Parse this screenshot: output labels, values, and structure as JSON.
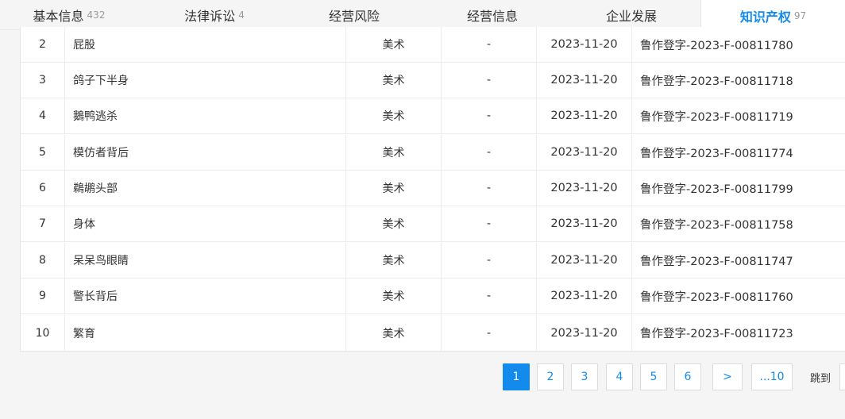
{
  "tabs": [
    {
      "label": "基本信息",
      "count": "432",
      "active": false
    },
    {
      "label": "法律诉讼",
      "count": "4",
      "active": false
    },
    {
      "label": "经营风险",
      "count": "",
      "active": false
    },
    {
      "label": "经营信息",
      "count": "",
      "active": false
    },
    {
      "label": "企业发展",
      "count": "",
      "active": false
    },
    {
      "label": "知识产权",
      "count": "97",
      "active": true
    }
  ],
  "rows": [
    {
      "idx": "2",
      "name": "屁股",
      "category": "美术",
      "dash": "-",
      "date": "2023-11-20",
      "reg_no": "鲁作登字-2023-F-00811780"
    },
    {
      "idx": "3",
      "name": "鸽子下半身",
      "category": "美术",
      "dash": "-",
      "date": "2023-11-20",
      "reg_no": "鲁作登字-2023-F-00811718"
    },
    {
      "idx": "4",
      "name": "鵝鸭逃杀",
      "category": "美术",
      "dash": "-",
      "date": "2023-11-20",
      "reg_no": "鲁作登字-2023-F-00811719"
    },
    {
      "idx": "5",
      "name": "模仿者背后",
      "category": "美术",
      "dash": "-",
      "date": "2023-11-20",
      "reg_no": "鲁作登字-2023-F-00811774"
    },
    {
      "idx": "6",
      "name": "鵜鹕头部",
      "category": "美术",
      "dash": "-",
      "date": "2023-11-20",
      "reg_no": "鲁作登字-2023-F-00811799"
    },
    {
      "idx": "7",
      "name": "身体",
      "category": "美术",
      "dash": "-",
      "date": "2023-11-20",
      "reg_no": "鲁作登字-2023-F-00811758"
    },
    {
      "idx": "8",
      "name": "呆呆鸟眼睛",
      "category": "美术",
      "dash": "-",
      "date": "2023-11-20",
      "reg_no": "鲁作登字-2023-F-00811747"
    },
    {
      "idx": "9",
      "name": "警长背后",
      "category": "美术",
      "dash": "-",
      "date": "2023-11-20",
      "reg_no": "鲁作登字-2023-F-00811760"
    },
    {
      "idx": "10",
      "name": "繁育",
      "category": "美术",
      "dash": "-",
      "date": "2023-11-20",
      "reg_no": "鲁作登字-2023-F-00811723"
    }
  ],
  "pagination": {
    "pages": [
      "1",
      "2",
      "3",
      "4",
      "5",
      "6"
    ],
    "current": "1",
    "next": ">",
    "last": "...10",
    "jump_label": "跳到"
  },
  "colors": {
    "accent": "#128bed"
  }
}
